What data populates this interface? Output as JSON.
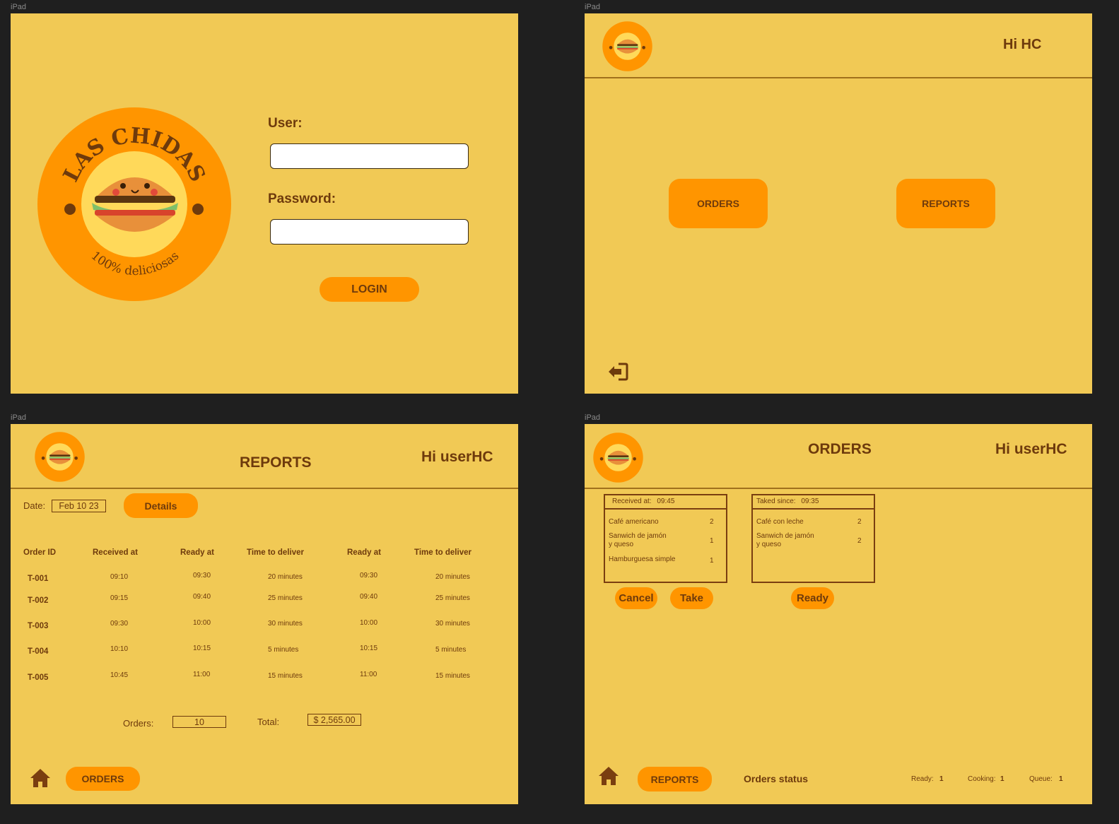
{
  "frame_label": "iPad",
  "colors": {
    "background": "#f1c955",
    "accent": "#ff9500",
    "text": "#6e3a0c"
  },
  "logo": {
    "brand": "LAS CHIDAS",
    "tagline": "100% deliciosas"
  },
  "login": {
    "user_label": "User:",
    "user_value": "",
    "password_label": "Password:",
    "password_value": "",
    "login_button": "LOGIN"
  },
  "home": {
    "greeting": "Hi HC",
    "orders_button": "ORDERS",
    "reports_button": "REPORTS",
    "logout_icon": "sign-out-icon"
  },
  "reports": {
    "title": "REPORTS",
    "greeting": "Hi userHC",
    "date_label": "Date:",
    "date_value": "Feb 10 23",
    "details_button": "Details",
    "columns": [
      "Order ID",
      "Received at",
      "Ready at",
      "Time to deliver",
      "Ready at",
      "Time to deliver"
    ],
    "rows": [
      [
        "T-001",
        "09:10",
        "09:30",
        "20 minutes",
        "09:30",
        "20 minutes"
      ],
      [
        "T-002",
        "09:15",
        "09:40",
        "25 minutes",
        "09:40",
        "25 minutes"
      ],
      [
        "T-003",
        "09:30",
        "10:00",
        "30 minutes",
        "10:00",
        "30 minutes"
      ],
      [
        "T-004",
        "10:10",
        "10:15",
        "5 minutes",
        "10:15",
        "5 minutes"
      ],
      [
        "T-005",
        "10:45",
        "11:00",
        "15 minutes",
        "11:00",
        "15 minutes"
      ]
    ],
    "orders_label": "Orders:",
    "orders_value": "10",
    "total_label": "Total:",
    "total_value": "$ 2,565.00",
    "home_icon": "home-icon",
    "orders_button": "ORDERS"
  },
  "orders": {
    "title": "ORDERS",
    "greeting": "Hi userHC",
    "received_card": {
      "header_label": "Received at:",
      "header_time": "09:45",
      "items": [
        {
          "name_lines": [
            "Café americano"
          ],
          "qty": "2"
        },
        {
          "name_lines": [
            "Sanwich de jamón",
            "y queso"
          ],
          "qty": "1"
        },
        {
          "name_lines": [
            "Hamburguesa simple"
          ],
          "qty": "1"
        }
      ],
      "cancel_button": "Cancel",
      "take_button": "Take"
    },
    "taken_card": {
      "header_label": "Taked since:",
      "header_time": "09:35",
      "items": [
        {
          "name_lines": [
            "Café con leche"
          ],
          "qty": "2"
        },
        {
          "name_lines": [
            "Sanwich de jamón",
            "y queso"
          ],
          "qty": "2"
        }
      ],
      "ready_button": "Ready"
    },
    "home_icon": "home-icon",
    "reports_button": "REPORTS",
    "status_title": "Orders status",
    "ready_label": "Ready:",
    "ready_value": "1",
    "cooking_label": "Cooking:",
    "cooking_value": "1",
    "queue_label": "Queue:",
    "queue_value": "1"
  }
}
